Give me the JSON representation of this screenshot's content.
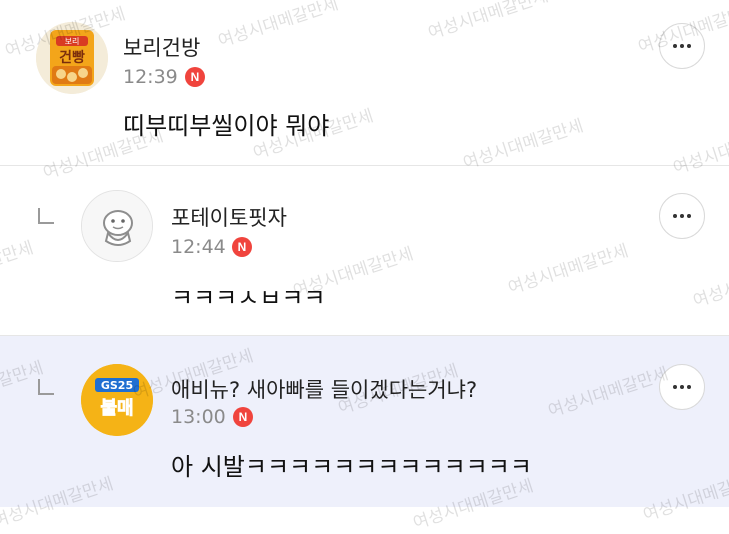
{
  "comments": [
    {
      "author": "보리건방",
      "time": "12:39",
      "new_badge": "N",
      "text": "띠부띠부씰이야 뭐야",
      "avatar_text": "건빵",
      "avatar_top_text": "보리"
    },
    {
      "author": "포테이토핏자",
      "time": "12:44",
      "new_badge": "N",
      "text": "ㅋㅋㅋㅅㅂㅋㅋ"
    },
    {
      "author": "애비뉴? 새아빠를 들이겠다는거냐?",
      "time": "13:00",
      "new_badge": "N",
      "text": "아 시발ㅋㅋㅋㅋㅋㅋㅋㅋㅋㅋㅋㅋㅋ",
      "avatar_top_text": "GS25",
      "avatar_text": "불매"
    }
  ],
  "watermark": "여성시대메갈만세",
  "colors": {
    "highlight_bg": "#eef0fb",
    "badge_red": "#f0443d",
    "meta_gray": "#8a8a8a"
  },
  "icons": {
    "more": "more-horizontal-icon",
    "reply": "reply-arrow-icon"
  }
}
